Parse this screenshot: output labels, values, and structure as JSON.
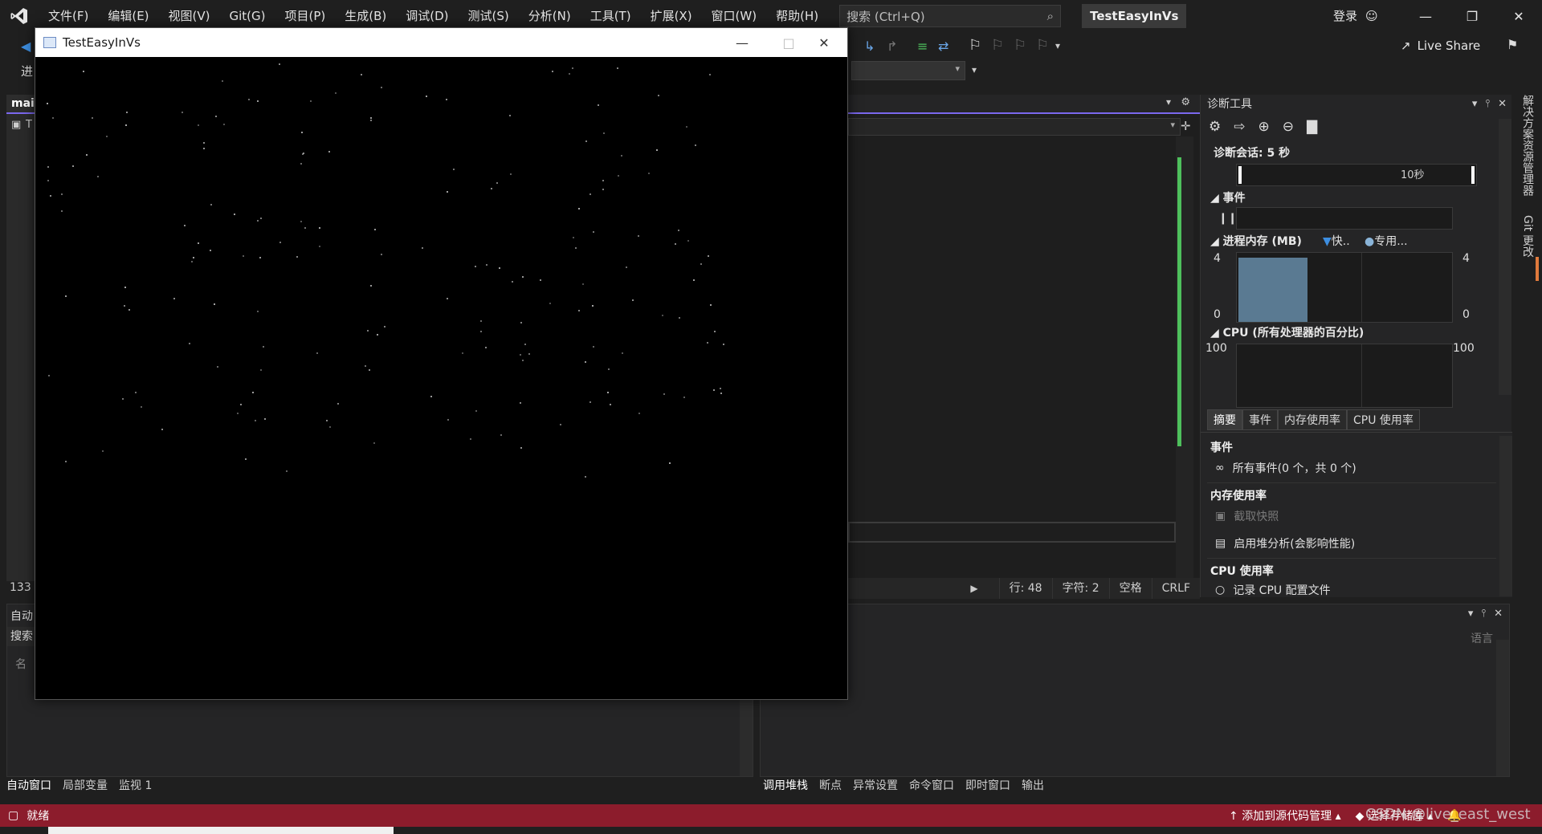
{
  "menubar": {
    "items": [
      "文件(F)",
      "编辑(E)",
      "视图(V)",
      "Git(G)",
      "项目(P)",
      "生成(B)",
      "调试(D)",
      "测试(S)",
      "分析(N)",
      "工具(T)",
      "扩展(X)",
      "窗口(W)",
      "帮助(H)"
    ],
    "search_placeholder": "搜索 (Ctrl+Q)",
    "solution_name": "TestEasyInVs",
    "login": "登录"
  },
  "toolbar": {
    "live_share": "Live Share",
    "left_label": "进"
  },
  "doc_tab": {
    "label": "mai",
    "sub": "T"
  },
  "editor_status": {
    "line": "行: 48",
    "char": "字符: 2",
    "spaces": "空格",
    "eol": "CRLF"
  },
  "left_zoom": "133 %",
  "diagnostics": {
    "title": "诊断工具",
    "session": "诊断会话: 5 秒",
    "timeline_label": "10秒",
    "events_title": "事件",
    "memory_title": "进程内存 (MB)",
    "memory_legend_snapshot": "快..",
    "memory_legend_private": "专用...",
    "memory_axis_max": "4",
    "memory_axis_min": "0",
    "cpu_title": "CPU (所有处理器的百分比)",
    "cpu_axis_max": "100",
    "cpu_axis_min": "0",
    "tabs": [
      "摘要",
      "事件",
      "内存使用率",
      "CPU 使用率"
    ],
    "lower": {
      "events_head": "事件",
      "all_events": "所有事件(0 个，共 0 个)",
      "memory_head": "内存使用率",
      "take_snapshot": "截取快照",
      "heap_analysis": "启用堆分析(会影响性能)",
      "cpu_head": "CPU 使用率",
      "record_cpu": "记录 CPU 配置文件"
    }
  },
  "right_vtabs": {
    "solution_explorer": "解决方案资源管理器",
    "git_changes": "Git 更改"
  },
  "auto_panel": {
    "title": "自动",
    "search": "搜索",
    "column": "名",
    "tabs": [
      "自动窗口",
      "局部变量",
      "监视 1"
    ]
  },
  "callstack_panel": {
    "lang": "语言",
    "tabs": [
      "调用堆栈",
      "断点",
      "异常设置",
      "命令窗口",
      "即时窗口",
      "输出"
    ]
  },
  "statusbar": {
    "ready": "就绪",
    "add_source": "添加到源代码管理",
    "select_repo": "选择存储库"
  },
  "watermark": "CSDN @live_east_west",
  "app_window": {
    "title": "TestEasyInVs"
  },
  "colors": {
    "status_bar": "#8c1c2c",
    "accent": "#7b68ee",
    "memory_bar": "#5a7a92"
  }
}
